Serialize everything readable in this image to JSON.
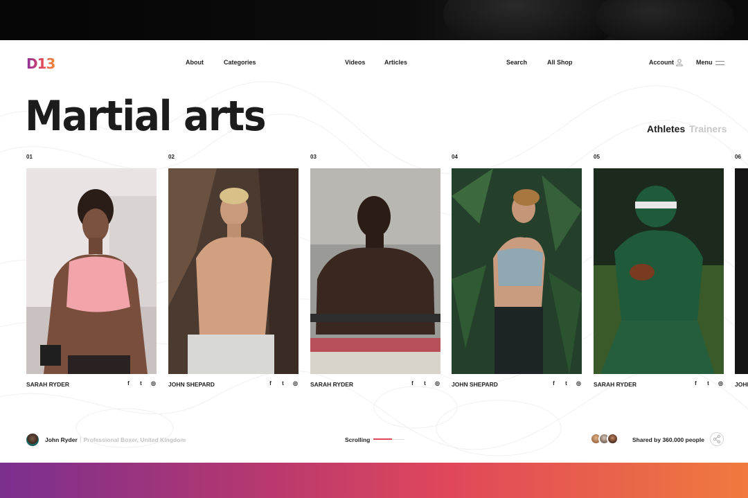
{
  "header": {
    "logo": "D13",
    "nav": [
      "About",
      "Categories",
      "Videos",
      "Articles",
      "Search",
      "All Shop",
      "Account",
      "Menu"
    ]
  },
  "page": {
    "title": "Martial arts",
    "tabs": [
      {
        "label": "Athletes",
        "active": true
      },
      {
        "label": "Trainers",
        "active": false
      }
    ]
  },
  "cards": [
    {
      "num": "01",
      "name": "SARAH RYDER"
    },
    {
      "num": "02",
      "name": "JOHN SHEPARD"
    },
    {
      "num": "03",
      "name": "SARAH RYDER"
    },
    {
      "num": "04",
      "name": "JOHN SHEPARD"
    },
    {
      "num": "05",
      "name": "SARAH RYDER"
    },
    {
      "num": "06",
      "name": "JOHN"
    }
  ],
  "social_icons": [
    "facebook-icon",
    "twitter-icon",
    "instagram-icon"
  ],
  "social_glyphs": {
    "facebook": "f",
    "twitter": "t",
    "instagram": "◎"
  },
  "footer": {
    "author_name": "John Ryder",
    "author_separator": "|",
    "author_role": "Professional Boxer, United Kingdom",
    "scrolling_label": "Scrolling",
    "scroll_progress": 0.6,
    "shared_text": "Shared by 360.000 people"
  },
  "colors": {
    "accent": "#e0475a",
    "gradient_start": "#7a2f8f",
    "gradient_end": "#f07a3e"
  }
}
